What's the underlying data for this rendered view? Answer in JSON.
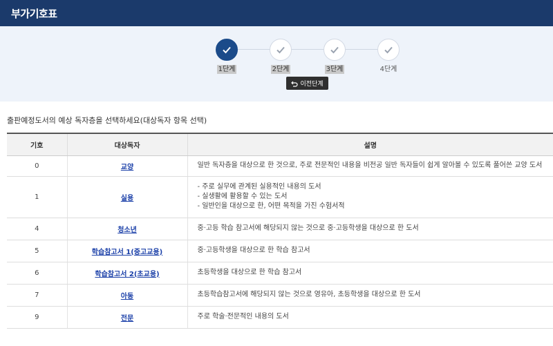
{
  "header": {
    "title": "부가기호표"
  },
  "stepper": {
    "steps": [
      {
        "label": "1단계",
        "state": "active"
      },
      {
        "label": "2단계",
        "state": "done"
      },
      {
        "label": "3단계",
        "state": "done"
      },
      {
        "label": "4단계",
        "state": "done"
      }
    ],
    "prev_button": "이전단계"
  },
  "instruction": "출판예정도서의 예상 독자층을 선택하세요(대상독자 항목 선택)",
  "table": {
    "headers": [
      "기호",
      "대상독자",
      "설명"
    ],
    "rows": [
      {
        "code": "0",
        "reader": "교양",
        "desc": [
          "일반 독자층을 대상으로 한 것으로, 주로 전문적인 내용을 비전공 일반 독자들이 쉽게 알아볼 수 있도록 풀어쓴 교양 도서"
        ]
      },
      {
        "code": "1",
        "reader": "실용",
        "desc": [
          "- 주로 실무에 관계된 실용적인 내용의 도서",
          "- 실생활에 활용할 수 있는 도서",
          "- 일반인을 대상으로 한, 어떤 목적을 가진 수험서적"
        ]
      },
      {
        "code": "4",
        "reader": "청소년",
        "desc": [
          "중·고등 학습 참고서에 해당되지 않는 것으로 중·고등학생을 대상으로 한 도서"
        ]
      },
      {
        "code": "5",
        "reader": "학습참고서 1(중고교용)",
        "desc": [
          "중·고등학생을 대상으로 한 학습 참고서"
        ]
      },
      {
        "code": "6",
        "reader": "학습참고서 2(초교용)",
        "desc": [
          "초등학생을 대상으로 한 학습 참고서"
        ]
      },
      {
        "code": "7",
        "reader": "아동",
        "desc": [
          "초등학습참고서에 해당되지 않는 것으로 영유아, 초등학생을 대상으로 한 도서"
        ]
      },
      {
        "code": "9",
        "reader": "전문",
        "desc": [
          "주로 학술·전문적인 내용의 도서"
        ]
      }
    ]
  },
  "colors": {
    "header_bg": "#1b3a6b",
    "step_active": "#1b4b8a",
    "link": "#1a3fa8"
  }
}
